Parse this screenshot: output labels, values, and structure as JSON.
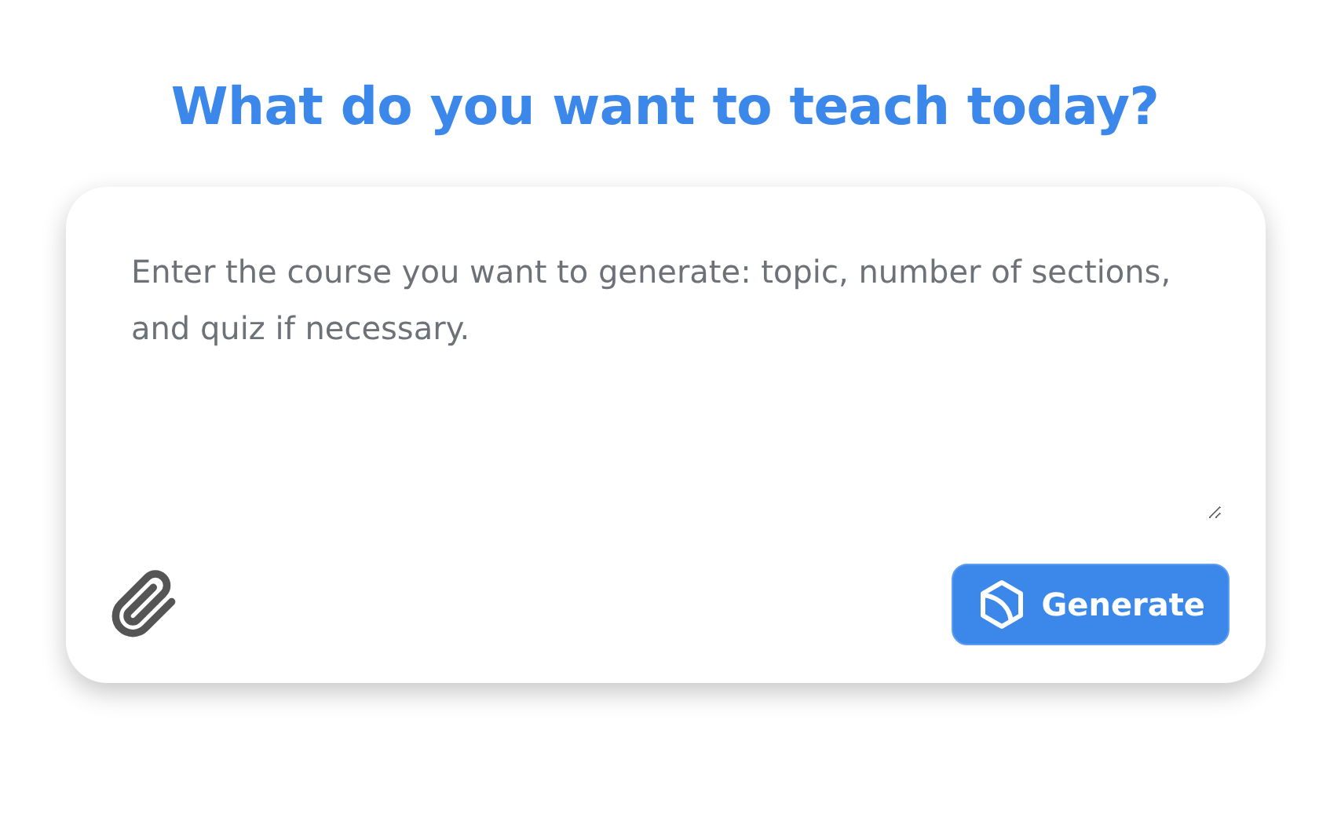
{
  "heading": "What do you want to teach today?",
  "prompt": {
    "placeholder": "Enter the course you want to generate: topic, number of sections, and quiz if necessary."
  },
  "generate_button": {
    "label": "Generate"
  }
}
